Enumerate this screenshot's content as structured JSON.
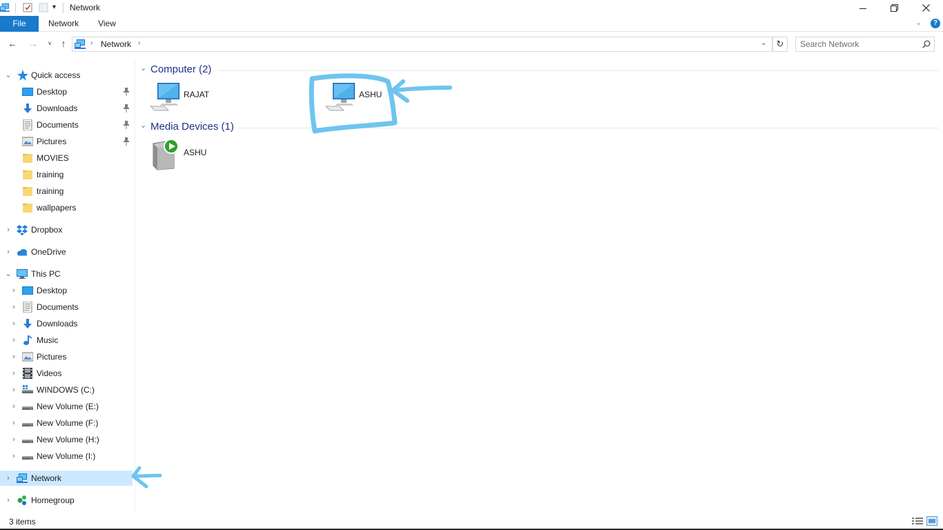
{
  "window": {
    "title": "Network"
  },
  "ribbon": {
    "tabs": [
      {
        "label": "File"
      },
      {
        "label": "Network"
      },
      {
        "label": "View"
      }
    ]
  },
  "address": {
    "crumb": "Network"
  },
  "search": {
    "placeholder": "Search Network"
  },
  "nav": {
    "quick_access": {
      "label": "Quick access",
      "items": [
        {
          "label": "Desktop",
          "icon": "desktop-icon",
          "pinned": true
        },
        {
          "label": "Downloads",
          "icon": "downloads-icon",
          "pinned": true
        },
        {
          "label": "Documents",
          "icon": "documents-icon",
          "pinned": true
        },
        {
          "label": "Pictures",
          "icon": "pictures-icon",
          "pinned": true
        },
        {
          "label": "MOVIES",
          "icon": "folder-icon",
          "pinned": false
        },
        {
          "label": "training",
          "icon": "folder-icon",
          "pinned": false
        },
        {
          "label": "training",
          "icon": "folder-icon",
          "pinned": false
        },
        {
          "label": "wallpapers",
          "icon": "folder-icon",
          "pinned": false
        }
      ]
    },
    "dropbox": {
      "label": "Dropbox"
    },
    "onedrive": {
      "label": "OneDrive"
    },
    "this_pc": {
      "label": "This PC",
      "items": [
        {
          "label": "Desktop",
          "icon": "desktop-icon"
        },
        {
          "label": "Documents",
          "icon": "documents-icon"
        },
        {
          "label": "Downloads",
          "icon": "downloads-icon"
        },
        {
          "label": "Music",
          "icon": "music-icon"
        },
        {
          "label": "Pictures",
          "icon": "pictures-icon"
        },
        {
          "label": "Videos",
          "icon": "videos-icon"
        },
        {
          "label": "WINDOWS (C:)",
          "icon": "windows-drive-icon"
        },
        {
          "label": "New Volume (E:)",
          "icon": "drive-icon"
        },
        {
          "label": "New Volume (F:)",
          "icon": "drive-icon"
        },
        {
          "label": "New Volume (H:)",
          "icon": "drive-icon"
        },
        {
          "label": "New Volume (I:)",
          "icon": "drive-icon"
        }
      ]
    },
    "network": {
      "label": "Network",
      "selected": true
    },
    "homegroup": {
      "label": "Homegroup"
    }
  },
  "content": {
    "computer_group": {
      "label": "Computer (2)",
      "items": [
        {
          "label": "RAJAT"
        },
        {
          "label": "ASHU"
        }
      ]
    },
    "media_group": {
      "label": "Media Devices (1)",
      "items": [
        {
          "label": "ASHU"
        }
      ]
    }
  },
  "status": {
    "count": "3 items"
  },
  "annotation_color": "#6ec4ef"
}
